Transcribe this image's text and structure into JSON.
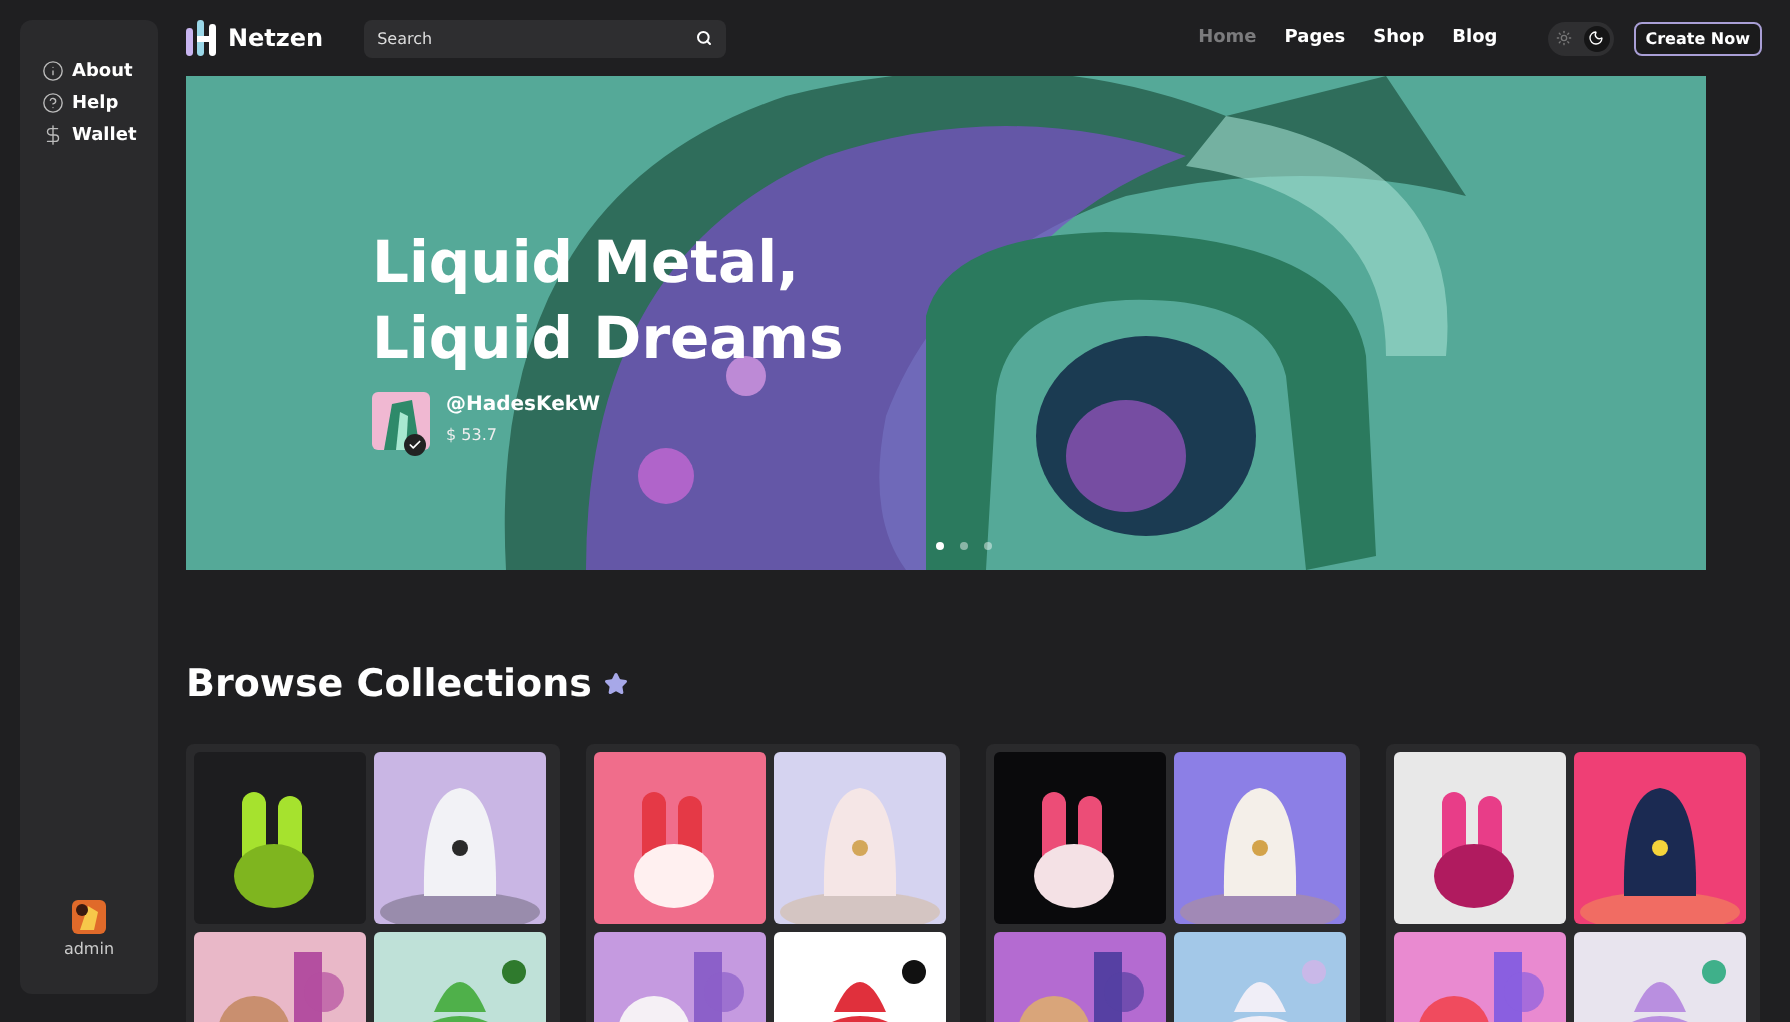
{
  "sidebar": {
    "items": [
      {
        "label": "About"
      },
      {
        "label": "Help"
      },
      {
        "label": "Wallet"
      }
    ],
    "user": {
      "name": "admin"
    }
  },
  "header": {
    "logo": "Netzen",
    "search": {
      "placeholder": "Search"
    },
    "nav": [
      {
        "label": "Home",
        "selected": true
      },
      {
        "label": "Pages",
        "selected": false
      },
      {
        "label": "Shop",
        "selected": false
      },
      {
        "label": "Blog",
        "selected": false
      }
    ],
    "theme": [
      {
        "selected": false
      },
      {
        "selected": true
      }
    ],
    "cta": "Create Now"
  },
  "hero": {
    "title_lines": [
      "Liquid Metal,",
      "Liquid Dreams"
    ],
    "author": "@HadesKekW",
    "price": "$ 53.7",
    "verified": true,
    "dots": [
      {
        "selected": true
      },
      {
        "selected": false
      },
      {
        "selected": false
      }
    ]
  },
  "collections": {
    "title": "Browse Collections"
  }
}
